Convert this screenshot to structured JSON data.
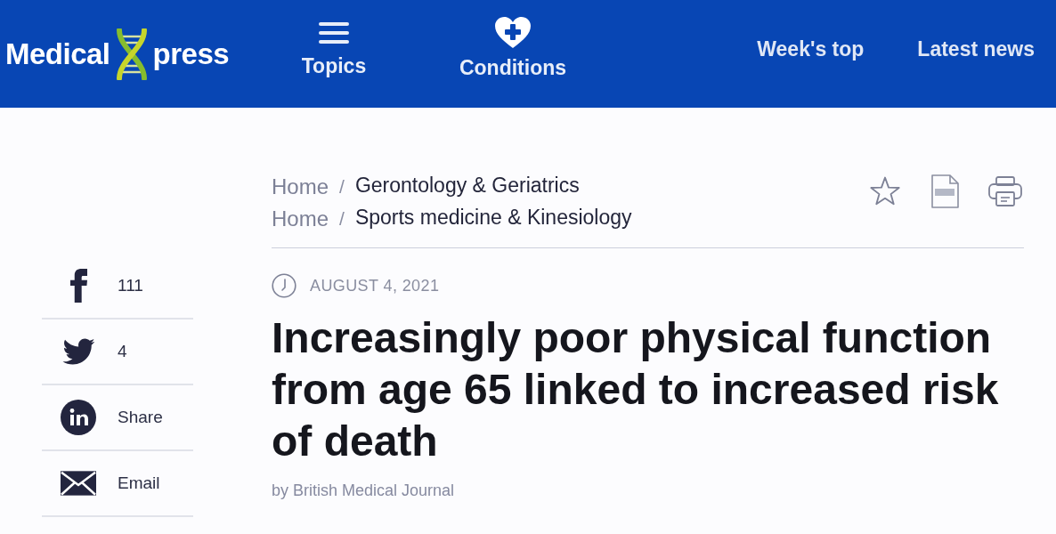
{
  "header": {
    "logo": {
      "text_before": "Medical",
      "text_after": "press"
    },
    "nav": [
      {
        "kind": "menu",
        "label": "Topics"
      },
      {
        "kind": "health",
        "label": "Conditions"
      }
    ],
    "links": [
      "Week's top",
      "Latest news"
    ]
  },
  "breadcrumbs": [
    {
      "home": "Home",
      "separator": "/",
      "category": "Gerontology & Geriatrics"
    },
    {
      "home": "Home",
      "separator": "/",
      "category": "Sports medicine & Kinesiology"
    }
  ],
  "share": [
    {
      "kind": "facebook",
      "label": "111"
    },
    {
      "kind": "twitter",
      "label": "4"
    },
    {
      "kind": "linkedin",
      "label": "Share"
    },
    {
      "kind": "email",
      "label": "Email"
    }
  ],
  "article": {
    "date": "AUGUST 4, 2021",
    "title": "Increasingly poor physical function from age 65 linked to increased risk of death",
    "byline": "by British Medical Journal"
  }
}
